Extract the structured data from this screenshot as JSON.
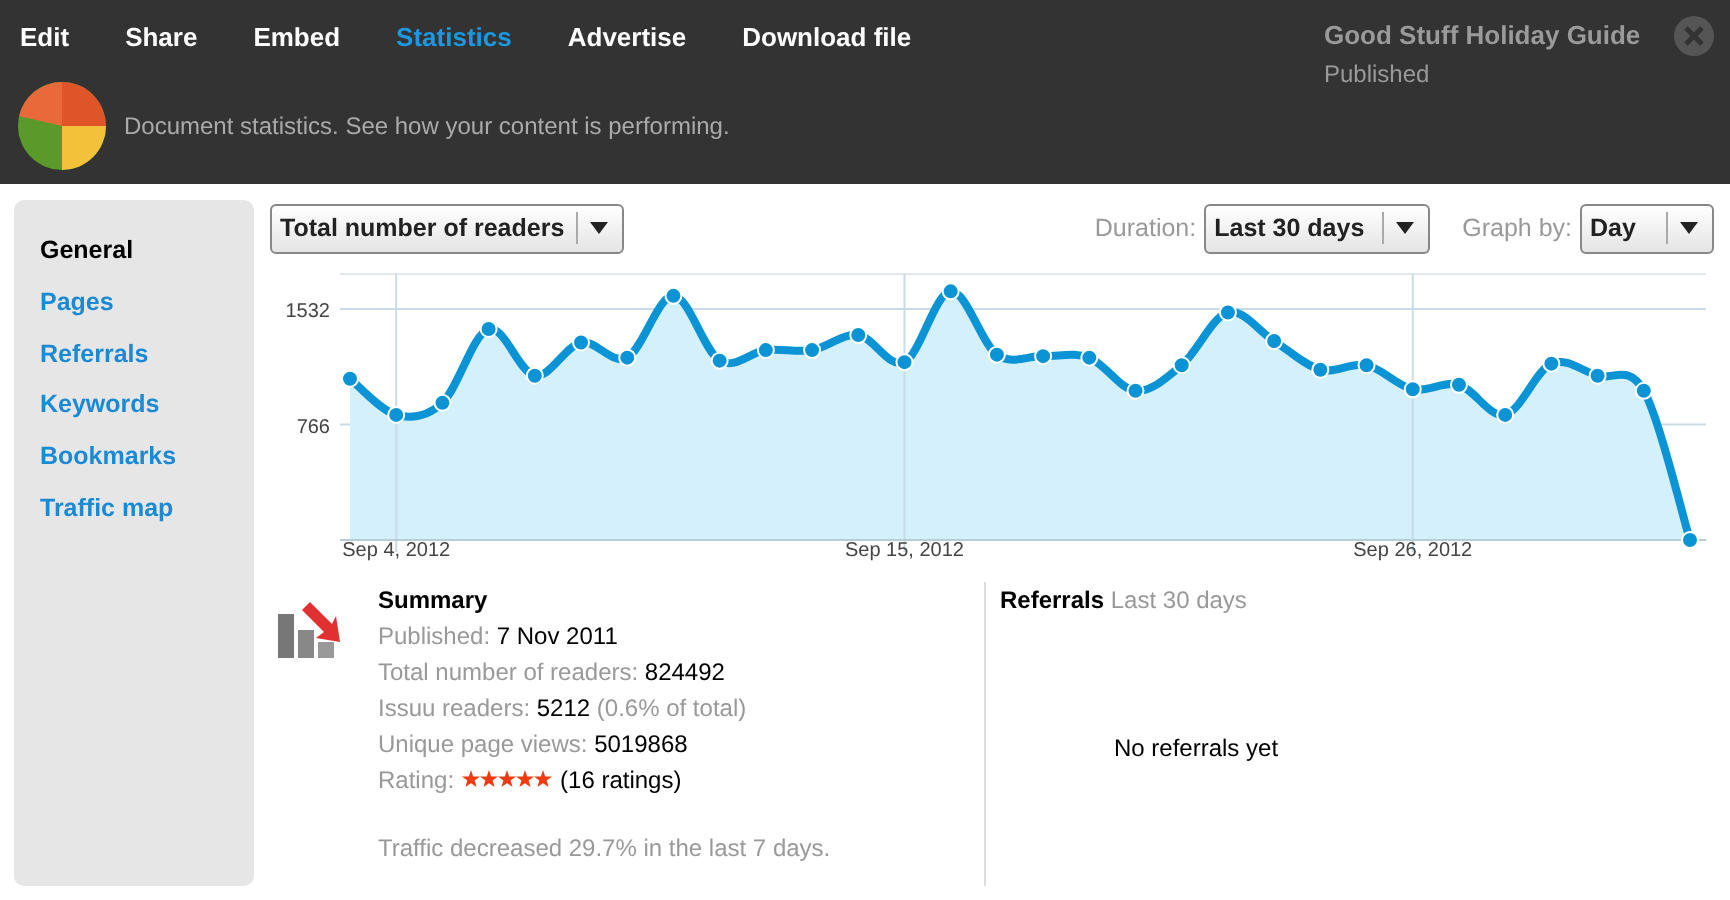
{
  "tabs": [
    {
      "label": "Edit",
      "selected": false
    },
    {
      "label": "Share",
      "selected": false
    },
    {
      "label": "Embed",
      "selected": false
    },
    {
      "label": "Statistics",
      "selected": true
    },
    {
      "label": "Advertise",
      "selected": false
    },
    {
      "label": "Download file",
      "selected": false
    }
  ],
  "document": {
    "title": "Good Stuff Holiday Guide",
    "status": "Published"
  },
  "header": {
    "description": "Document statistics. See how your content is performing."
  },
  "sidebar": {
    "items": [
      {
        "label": "General",
        "selected": true
      },
      {
        "label": "Pages",
        "selected": false
      },
      {
        "label": "Referrals",
        "selected": false
      },
      {
        "label": "Keywords",
        "selected": false
      },
      {
        "label": "Bookmarks",
        "selected": false
      },
      {
        "label": "Traffic map",
        "selected": false
      }
    ]
  },
  "controls": {
    "metric": "Total number of readers",
    "duration_label": "Duration:",
    "duration": "Last 30 days",
    "graph_by_label": "Graph by:",
    "graph_by": "Day"
  },
  "chart": {
    "chart_data": {
      "type": "area",
      "categories": [
        null,
        "Sep 4, 2012",
        null,
        null,
        null,
        null,
        null,
        null,
        null,
        null,
        null,
        null,
        "Sep 15, 2012",
        null,
        null,
        null,
        null,
        null,
        null,
        null,
        null,
        null,
        null,
        "Sep 26, 2012",
        null,
        null,
        null,
        null,
        null,
        null
      ],
      "series": [
        {
          "color": "#0a94d6",
          "values": [
            1070,
            830,
            910,
            1400,
            1090,
            1310,
            1210,
            1620,
            1190,
            1260,
            1260,
            1360,
            1180,
            1650,
            1230,
            1220,
            1210,
            990,
            1160,
            1510,
            1320,
            1130,
            1160,
            1000,
            1030,
            830,
            1170,
            1090,
            990,
            0
          ]
        }
      ],
      "ylim": [
        0,
        1765
      ],
      "yticks": [
        766,
        1532
      ],
      "grid": true
    }
  },
  "summary": {
    "title": "Summary",
    "rows": [
      {
        "label": "Published:",
        "value": "7 Nov 2011"
      },
      {
        "label": "Total number of readers:",
        "value": "824492"
      },
      {
        "label": "Issuu readers:",
        "value": "5212",
        "extra": "(0.6% of total)"
      },
      {
        "label": "Unique page views:",
        "value": "5019868"
      }
    ],
    "rating": {
      "label": "Rating:",
      "stars": 5,
      "count": "(16 ratings)"
    },
    "note": "Traffic decreased 29.7% in the last 7 days."
  },
  "referrals": {
    "title": "Referrals",
    "period": "Last 30 days",
    "empty": "No referrals yet"
  }
}
